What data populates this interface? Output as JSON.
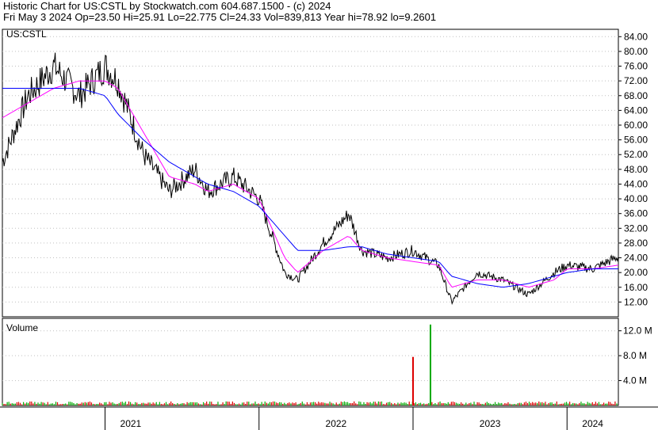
{
  "header": {
    "line1": "Historic Chart for US:CSTL by Stockwatch.com 604.687.1500 - (c) 2024",
    "line2": "Fri May  3 2024  Op=23.50  Hi=25.91  Lo=22.775  Cl=24.33  Vol=839,813  Year hi=78.92  lo=9.2601"
  },
  "chart_data": {
    "type": "line",
    "symbol_label": "US:CSTL",
    "volume_label": "Volume",
    "price_axis": {
      "ticks": [
        "84.00",
        "80.00",
        "76.00",
        "72.00",
        "68.00",
        "64.00",
        "60.00",
        "56.00",
        "52.00",
        "48.00",
        "44.00",
        "40.00",
        "36.00",
        "32.00",
        "28.00",
        "24.00",
        "20.00",
        "16.00",
        "12.00"
      ],
      "ylim": [
        8,
        86
      ]
    },
    "volume_axis": {
      "ticks": [
        "12.0 M",
        "8.0 M",
        "4.0 M"
      ],
      "ylim": [
        0,
        14
      ]
    },
    "x_labels": [
      "2021",
      "2022",
      "2023",
      "2024"
    ],
    "x_range": [
      "2020-05",
      "2024-05"
    ],
    "colors": {
      "price": "#000000",
      "ma_short": "#ff00ff",
      "ma_long": "#0000ff",
      "vol_up": "#00aa00",
      "vol_down": "#dd0000",
      "grid": "#c0c0c0"
    },
    "series": [
      {
        "values_key": "price",
        "dates": [
          "2020-05",
          "2020-07",
          "2020-09",
          "2020-11",
          "2021-01",
          "2021-02",
          "2021-04",
          "2021-06",
          "2021-08",
          "2021-09",
          "2021-11",
          "2022-01",
          "2022-03",
          "2022-04",
          "2022-06",
          "2022-08",
          "2022-09",
          "2022-11",
          "2023-01",
          "2023-03",
          "2023-04",
          "2023-06",
          "2023-08",
          "2023-10",
          "2023-12",
          "2024-01",
          "2024-03",
          "2024-05"
        ],
        "values": [
          50,
          68,
          76,
          68,
          76,
          72,
          52,
          42,
          48,
          42,
          46,
          40,
          20,
          18,
          28,
          36,
          26,
          24,
          26,
          22,
          12,
          20,
          18,
          14,
          20,
          22,
          21,
          24.3
        ]
      },
      {
        "values_key": "ma_short",
        "dates": [
          "2020-05",
          "2020-07",
          "2020-09",
          "2020-11",
          "2021-01",
          "2021-02",
          "2021-04",
          "2021-06",
          "2021-08",
          "2021-09",
          "2021-11",
          "2022-01",
          "2022-03",
          "2022-04",
          "2022-06",
          "2022-08",
          "2022-09",
          "2022-11",
          "2023-01",
          "2023-03",
          "2023-04",
          "2023-06",
          "2023-08",
          "2023-10",
          "2023-12",
          "2024-01",
          "2024-03",
          "2024-05"
        ],
        "values": [
          62,
          66,
          70,
          72,
          72,
          70,
          58,
          46,
          44,
          42,
          44,
          40,
          24,
          20,
          26,
          30,
          26,
          24,
          23,
          22,
          16,
          18,
          18,
          16,
          18,
          21,
          21,
          22
        ]
      },
      {
        "values_key": "ma_long",
        "dates": [
          "2020-05",
          "2020-07",
          "2020-09",
          "2020-11",
          "2021-01",
          "2021-02",
          "2021-04",
          "2021-06",
          "2021-08",
          "2021-09",
          "2021-11",
          "2022-01",
          "2022-03",
          "2022-04",
          "2022-06",
          "2022-08",
          "2022-09",
          "2022-11",
          "2023-01",
          "2023-03",
          "2023-04",
          "2023-06",
          "2023-08",
          "2023-10",
          "2023-12",
          "2024-01",
          "2024-03",
          "2024-05"
        ],
        "values": [
          70,
          70,
          70,
          70,
          68,
          63,
          56,
          50,
          46,
          44,
          42,
          38,
          30,
          26,
          26,
          27,
          27,
          25,
          24,
          23,
          19,
          17,
          16,
          17,
          19,
          20,
          21,
          21
        ]
      }
    ],
    "volume": {
      "note": "volume bars mostly near baseline with spikes",
      "spikes": [
        {
          "date": "2023-01",
          "value": 7.8,
          "color": "down"
        },
        {
          "date": "2023-01",
          "value": 13.0,
          "color": "up"
        }
      ]
    }
  }
}
